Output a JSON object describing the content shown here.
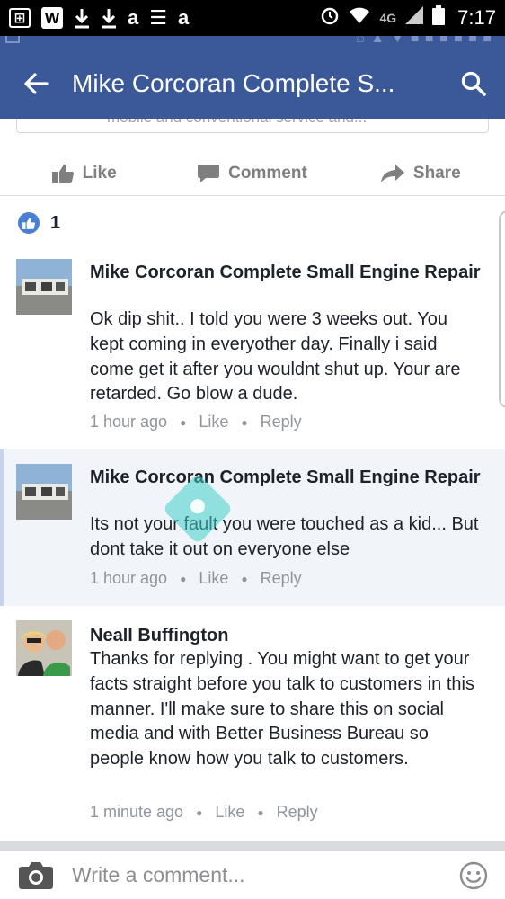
{
  "status_bar": {
    "left_icons": [
      "gallery-icon",
      "word-icon",
      "download-icon",
      "download-icon",
      "amazon-icon",
      "news-icon",
      "amazon-icon"
    ],
    "left_labels": [
      "⊞",
      "W",
      "⭳",
      "⭳",
      "a",
      "☰",
      "a"
    ],
    "network": "4G",
    "time": "7:17"
  },
  "app_bar": {
    "title": "Mike Corcoran Complete S..."
  },
  "actions": {
    "like": "Like",
    "comment": "Comment",
    "share": "Share"
  },
  "reactions": {
    "count": "1"
  },
  "comments": [
    {
      "author": "Mike Corcoran Complete Small Engine Repair",
      "text": "Ok dip shit.. I told you were 3 weeks out. You kept coming in everyother day. Finally i said come get it after you wouldnt shut up. Your are retarded. Go blow a dude.",
      "time": "1 hour ago",
      "like": "Like",
      "reply": "Reply"
    },
    {
      "author": "Mike Corcoran Complete Small Engine Repair",
      "text": "Its not your fault you were touched as a kid... But dont take it out on everyone else",
      "time": "1 hour ago",
      "like": "Like",
      "reply": "Reply"
    },
    {
      "author": "Neall Buffington",
      "text": "Thanks for replying . You might want to get your facts straight before you talk to customers in this manner. I'll  make sure to share this on social media and with Better Business Bureau  so people know how you talk to  customers.",
      "time": "1 minute ago",
      "like": "Like",
      "reply": "Reply"
    }
  ],
  "composer": {
    "placeholder": "Write a comment..."
  },
  "colors": {
    "header": "#3b5998",
    "like_bubble": "#4a7fd4",
    "meta_text": "#90949c"
  }
}
